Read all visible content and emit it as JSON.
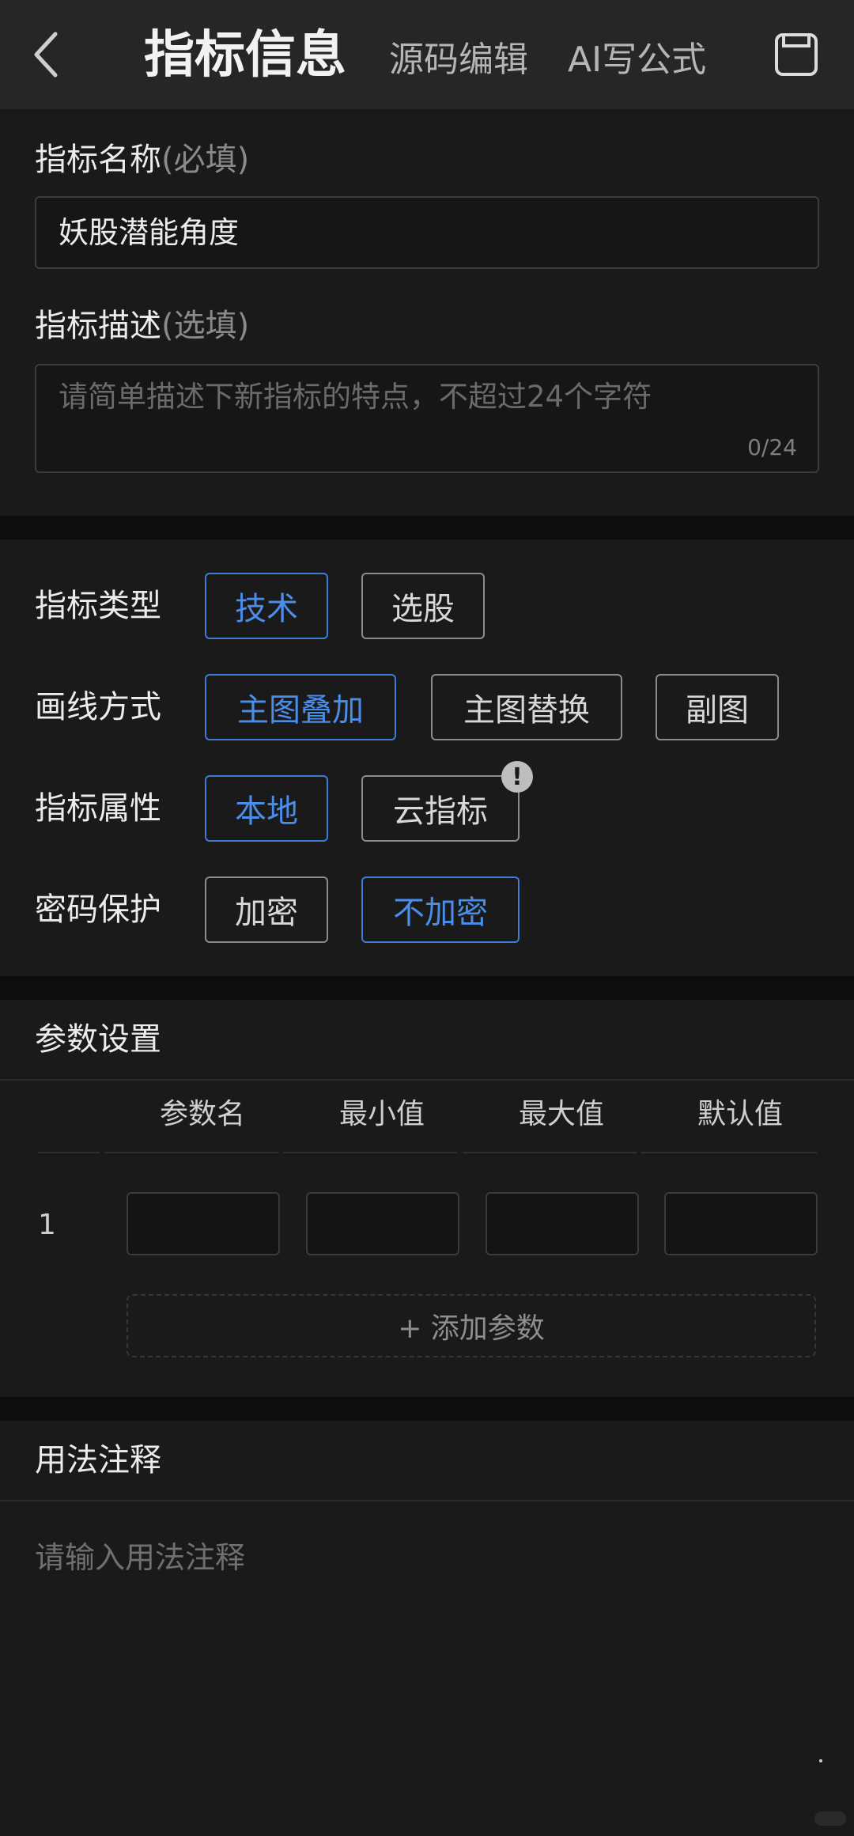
{
  "header": {
    "title": "指标信息",
    "tabs": [
      {
        "label": "源码编辑"
      },
      {
        "label": "AI写公式"
      }
    ],
    "back_icon": "chevron-left-icon",
    "save_icon": "save-icon"
  },
  "info": {
    "name_label": "指标名称",
    "name_hint": "(必填)",
    "name_value": "妖股潜能角度",
    "desc_label": "指标描述",
    "desc_hint": "(选填)",
    "desc_placeholder": "请简单描述下新指标的特点，不超过24个字符",
    "desc_counter": "0/24"
  },
  "options": {
    "type": {
      "label": "指标类型",
      "items": [
        {
          "label": "技术"
        },
        {
          "label": "选股"
        }
      ],
      "selected": "技术"
    },
    "draw": {
      "label": "画线方式",
      "items": [
        {
          "label": "主图叠加"
        },
        {
          "label": "主图替换"
        },
        {
          "label": "副图"
        }
      ],
      "selected": "主图叠加"
    },
    "attr": {
      "label": "指标属性",
      "items": [
        {
          "label": "本地"
        },
        {
          "label": "云指标"
        }
      ],
      "selected": "本地",
      "badge": "!"
    },
    "password": {
      "label": "密码保护",
      "items": [
        {
          "label": "加密"
        },
        {
          "label": "不加密"
        }
      ],
      "selected": "不加密"
    }
  },
  "params": {
    "title": "参数设置",
    "columns": [
      "参数名",
      "最小值",
      "最大值",
      "默认值"
    ],
    "rows": [
      {
        "index": "1",
        "cells": [
          "",
          "",
          "",
          ""
        ]
      }
    ],
    "add_label": "+ 添加参数"
  },
  "usage": {
    "title": "用法注释",
    "placeholder": "请输入用法注释"
  },
  "colors": {
    "accent": "#3b7dd8",
    "background": "#1a1a1a",
    "header": "#262626"
  }
}
